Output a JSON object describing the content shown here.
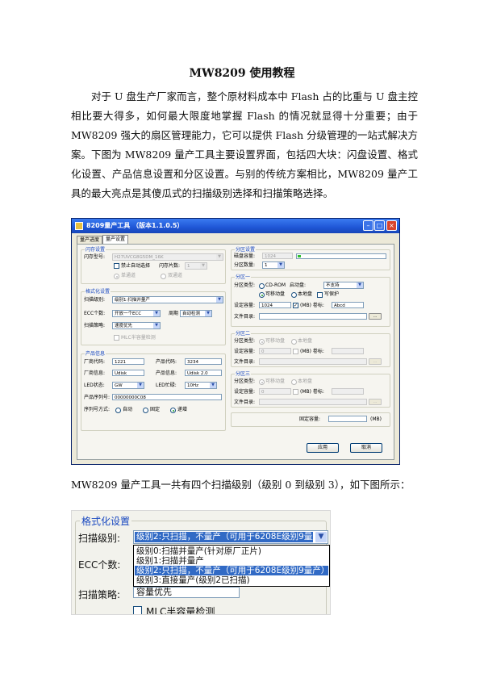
{
  "doc": {
    "title": "MW8209 使用教程",
    "para1": "对于 U 盘生产厂家而言，整个原材料成本中 Flash 占的比重与 U 盘主控相比要大得多，如何最大限度地掌握 Flash 的情况就显得十分重要；由于 MW8209 强大的扇区管理能力，它可以提供 Flash 分级管理的一站式解决方案。",
    "para2": "下图为 MW8209 量产工具主要设置界面，包括四大块：闪盘设置、格式化设置、产品信息设置和分区设置。与别的传统方案相比，MW8209 量产工具的最大亮点是其傻瓜式的扫描级别选择和扫描策略选择。",
    "caption": "MW8209 量产工具一共有四个扫描级别（级别 0 到级别 3），如下图所示："
  },
  "window": {
    "title": "8209量产工具 （版本1.1.0.5）",
    "tabs": [
      "量产进度",
      "量产设置"
    ],
    "flash_group": {
      "title": "闪存设置",
      "model_label": "闪存型号:",
      "model_value": "H27UVCG8G5DM_16K",
      "auto_select_label": "禁止自动选择",
      "chip_count_label": "闪存片数:",
      "chip_count_value": "1",
      "single_channel": "单通道",
      "dual_channel": "双通道"
    },
    "format_group": {
      "title": "格式化设置",
      "scan_level_label": "扫描级别:",
      "scan_level_value": "级别1:扫描并量产",
      "ecc_label": "ECC个数:",
      "ecc_value": "开放一个ECC",
      "cycle_label": "周期",
      "cycle_value": "自动检测",
      "strategy_label": "扫描策略:",
      "strategy_value": "速度优先",
      "mlc_label": "MLC半容量检测"
    },
    "product_group": {
      "title": "产品信息",
      "vendor_code_label": "厂商代码:",
      "vendor_code_value": "1221",
      "product_code_label": "产品代码:",
      "product_code_value": "3234",
      "vendor_info_label": "厂商信息:",
      "vendor_info_value": "Udisk",
      "product_info_label": "产品信息:",
      "product_info_value": "Udisk 2.0",
      "led_state_label": "LED状态:",
      "led_state_value": "GW",
      "led_blink_label": "LED忙碌:",
      "led_blink_value": "10Hz",
      "serial_label": "产品序列号:",
      "serial_value": "00000000C08",
      "serial_mode_label": "序列号方式:",
      "serial_auto": "自动",
      "serial_fixed": "固定",
      "serial_inc": "递增"
    },
    "partition_group": {
      "title": "分区设置",
      "capacity_label": "磁盘容量:",
      "capacity_value": "1024",
      "capacity_fill": 0.04,
      "count_label": "分区数量:",
      "count_value": "1"
    },
    "partition1": {
      "title": "分区一",
      "type_label": "分区类型:",
      "cdrom": "CD-ROM",
      "boot_label": "启动盘:",
      "boot_value": "不支持",
      "removable": "可移动盘",
      "local": "本地盘",
      "write_protect": "写保护",
      "size_label": "设定容量:",
      "size_value": "1024",
      "mb_label": "(MB) 卷标:",
      "volume_value": "Abcd",
      "dir_label": "文件目录:",
      "browse": "..."
    },
    "partition2": {
      "title": "分区二",
      "type_label": "分区类型:",
      "removable": "可移动盘",
      "local": "本地盘",
      "size_label": "设定容量:",
      "size_value": "0",
      "mb_label": "(MB) 卷标:",
      "dir_label": "文件目录:",
      "browse": "..."
    },
    "partition3": {
      "title": "分区三",
      "type_label": "分区类型:",
      "removable": "可移动盘",
      "local": "本地盘",
      "size_label": "设定容量:",
      "size_value": "0",
      "mb_label": "(MB) 卷标:",
      "dir_label": "文件目录:",
      "browse": "..."
    },
    "fixed_capacity_label": "固定容量:",
    "fixed_capacity_unit": "(MB)",
    "apply": "应用",
    "cancel": "取消"
  },
  "zoom": {
    "group_title": "格式化设置",
    "scan_level_label": "扫描级别:",
    "scan_level_value": "级别2:只扫描，不量产（可用于6208E级别9量产）",
    "options": [
      "级别0:扫描并量产(针对原厂正片)",
      "级别1:扫描并量产",
      "级别2:只扫描，不量产（可用于6208E级别9量产）",
      "级别3:直接量产(级别2已扫描)"
    ],
    "selected_index": 2,
    "ecc_label": "ECC个数:",
    "strategy_label": "扫描策略:",
    "strategy_value": "容量优先",
    "mlc_label": "MLC半容量检测"
  }
}
